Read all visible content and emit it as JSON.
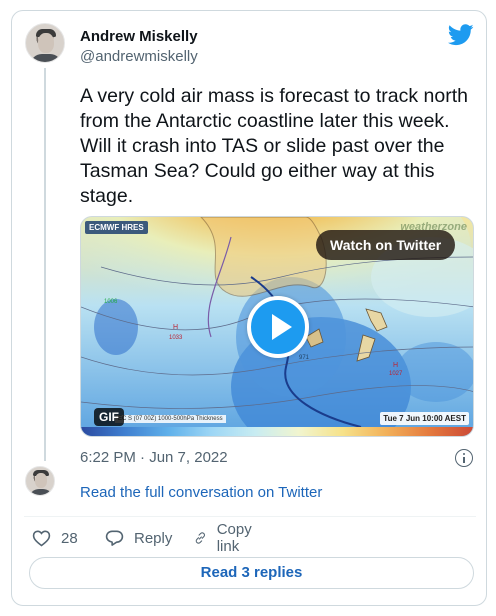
{
  "author": {
    "name": "Andrew Miskelly",
    "handle": "@andrewmiskelly"
  },
  "tweet": {
    "text": "A very cold air mass is forecast to track north from the Antarctic coastline later this week. Will it crash into TAS or slide past over the Tasman Sea? Could go either way at this stage."
  },
  "media": {
    "model_badge": "ECMWF HRES",
    "watermark": "weatherzone",
    "watch_label": "Watch on Twitter",
    "gif_badge": "GIF",
    "map_caption": "EC         S (07 00Z) 1000-500hPa Thickness",
    "map_date": "Tue 7 Jun 10:00 AEST",
    "pressure_labels": [
      "1006",
      "H",
      "1033",
      "971",
      "H",
      "1027"
    ]
  },
  "meta": {
    "timestamp": "6:22 PM · Jun 7, 2022"
  },
  "conversation": {
    "link": "Read the full conversation on Twitter"
  },
  "actions": {
    "like_count": "28",
    "reply_label": "Reply",
    "copy_label": "Copy link"
  },
  "replies": {
    "button": "Read 3 replies"
  },
  "colors": {
    "twitter_blue": "#1d9bf0",
    "link_blue": "#1d66b9",
    "text_primary": "#0f1419",
    "text_secondary": "#536471",
    "border": "#cfd9de"
  },
  "icons": {
    "brand": "twitter-bird-icon",
    "info": "info-icon",
    "like": "heart-icon",
    "reply": "reply-bubble-icon",
    "copy": "link-icon",
    "play": "play-icon"
  }
}
